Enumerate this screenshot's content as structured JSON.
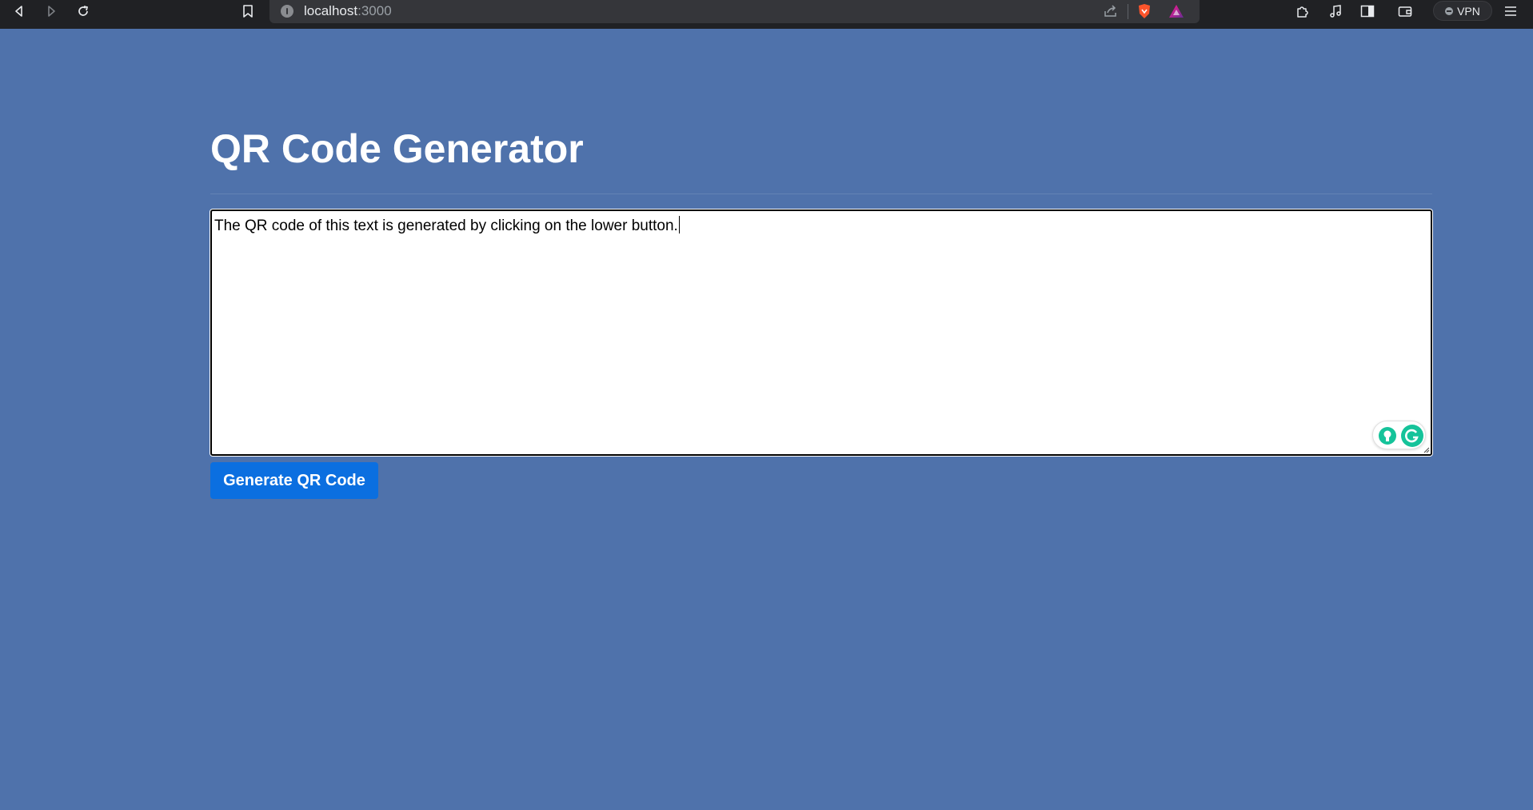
{
  "browser": {
    "url_host": "localhost",
    "url_port": ":3000",
    "vpn_label": "VPN"
  },
  "page": {
    "title": "QR Code Generator",
    "textarea_value": "The QR code of this text is generated by clicking on the lower button.",
    "generate_button_label": "Generate QR Code"
  },
  "colors": {
    "background": "#4f72ab",
    "button": "#0b6fe0",
    "chrome": "#202124",
    "grammarly": "#15c39a"
  },
  "icons": [
    "back-icon",
    "forward-icon",
    "reload-icon",
    "bookmark-icon",
    "site-info-icon",
    "share-icon",
    "brave-shield-icon",
    "brave-rewards-icon",
    "extensions-icon",
    "media-icon",
    "sidebar-icon",
    "wallet-icon",
    "vpn-icon",
    "menu-icon",
    "grammarly-bulb-icon",
    "grammarly-logo-icon"
  ]
}
